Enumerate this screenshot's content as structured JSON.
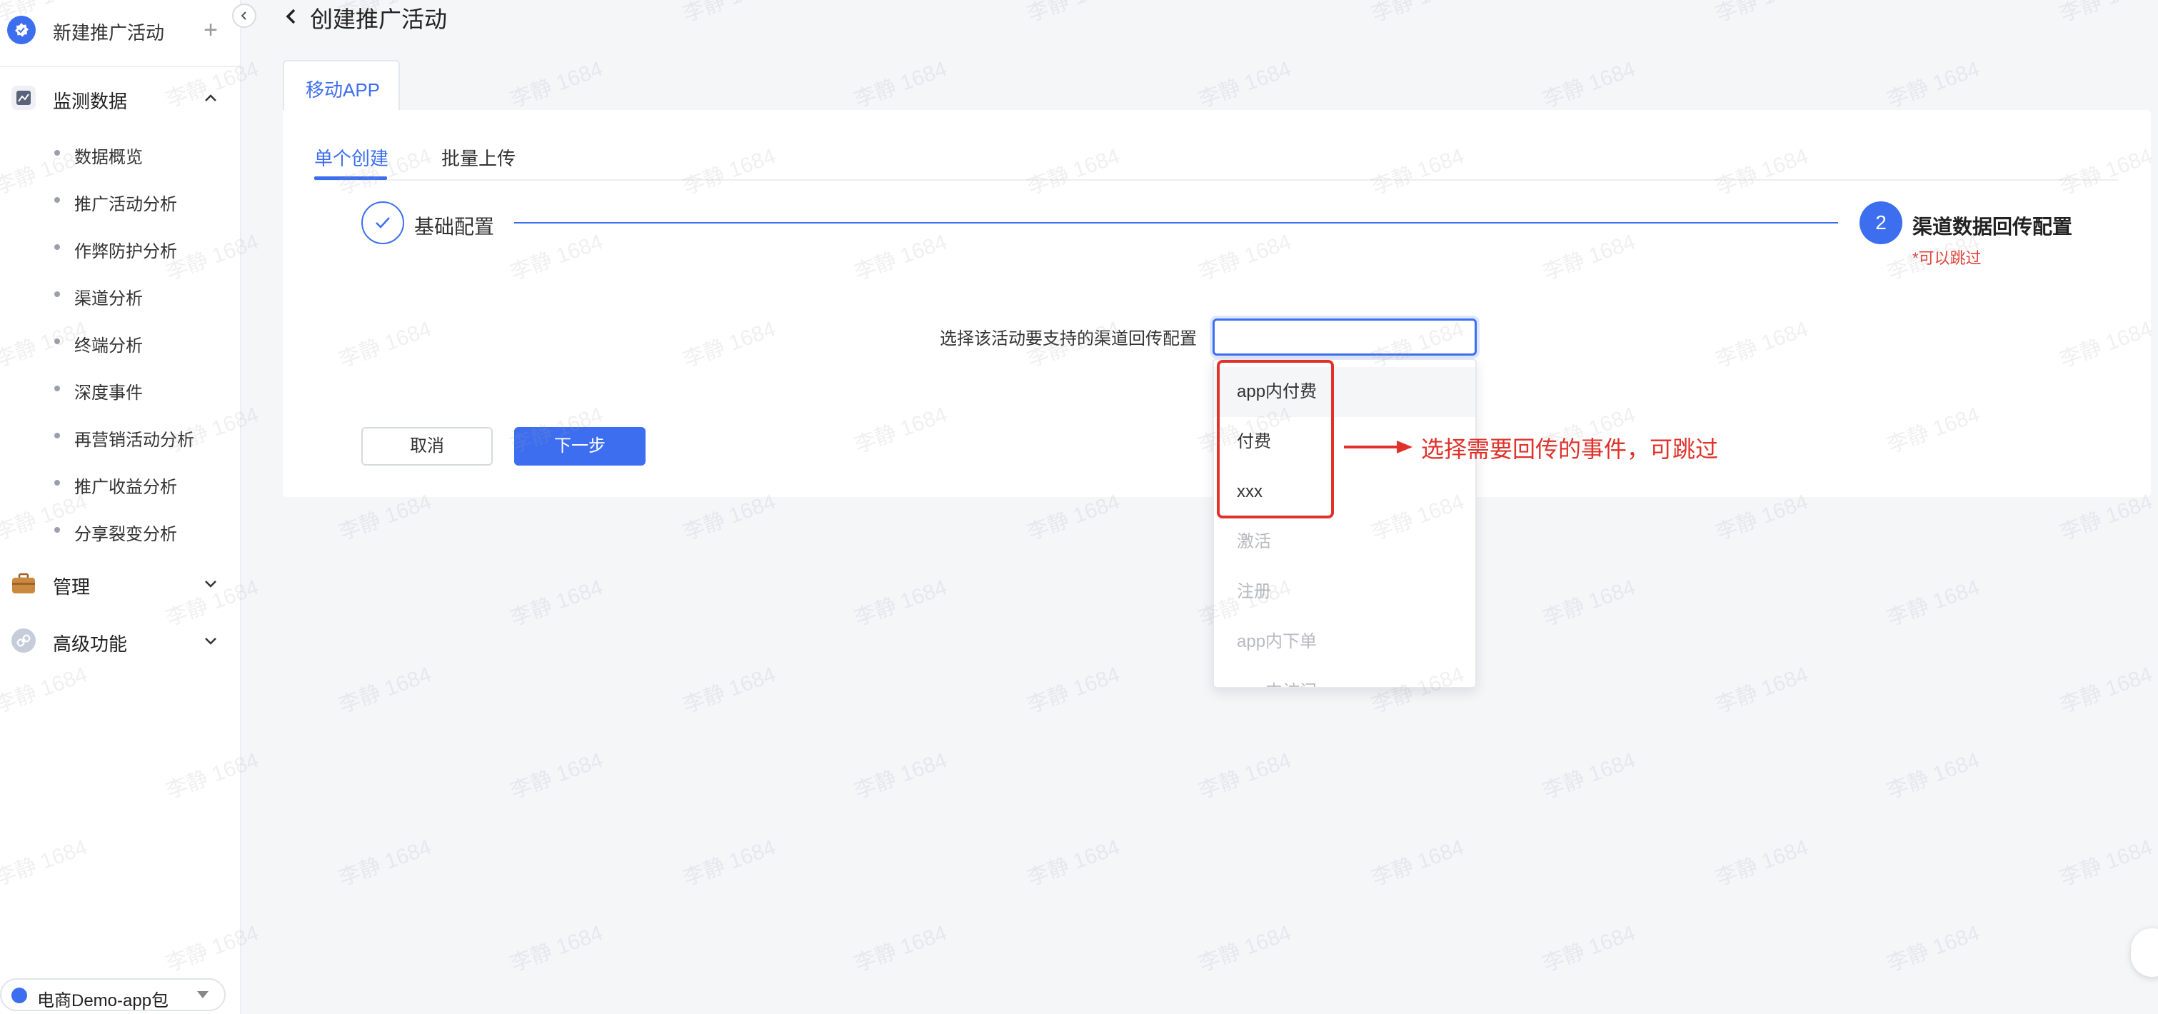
{
  "sidebar": {
    "brand_label": "新建推广活动",
    "groups": {
      "monitor": "监测数据",
      "manage": "管理",
      "advanced": "高级功能"
    },
    "items": [
      {
        "label": "数据概览"
      },
      {
        "label": "推广活动分析"
      },
      {
        "label": "作弊防护分析"
      },
      {
        "label": "渠道分析"
      },
      {
        "label": "终端分析"
      },
      {
        "label": "深度事件"
      },
      {
        "label": "再营销活动分析"
      },
      {
        "label": "推广收益分析"
      },
      {
        "label": "分享裂变分析"
      }
    ],
    "app_switch": "电商Demo-app包"
  },
  "header": {
    "title": "创建推广活动"
  },
  "platform_tab": "移动APP",
  "tabs": [
    "单个创建",
    "批量上传"
  ],
  "steps": {
    "step1_label": "基础配置",
    "step2_number": "2",
    "step2_label": "渠道数据回传配置",
    "step2_note": "*可以跳过"
  },
  "form": {
    "label": "选择该活动要支持的渠道回传配置",
    "value": ""
  },
  "buttons": {
    "cancel": "取消",
    "next": "下一步"
  },
  "dropdown": {
    "options": [
      {
        "label": "app内付费",
        "enabled": true
      },
      {
        "label": "付费",
        "enabled": true
      },
      {
        "label": "xxx",
        "enabled": true
      },
      {
        "label": "激活",
        "enabled": false
      },
      {
        "label": "注册",
        "enabled": false
      },
      {
        "label": "app内下单",
        "enabled": false
      },
      {
        "label": "app内访问",
        "enabled": false
      }
    ]
  },
  "annotation": "选择需要回传的事件，可跳过",
  "watermark": "李静 1684",
  "colors": {
    "accent": "#3d6ef0",
    "annotation_red": "#e0312a"
  }
}
